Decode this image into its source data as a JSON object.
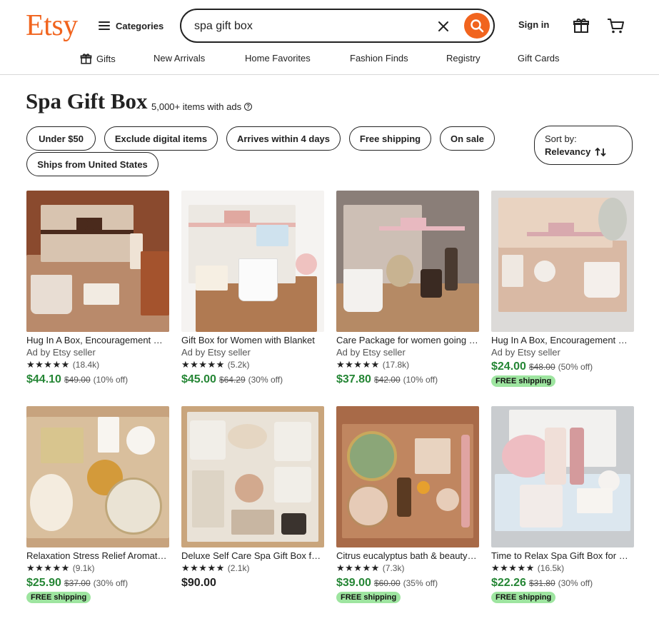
{
  "header": {
    "logo": "Etsy",
    "categories_label": "Categories",
    "search_value": "spa gift box",
    "signin_label": "Sign in"
  },
  "subnav": [
    "Gifts",
    "New Arrivals",
    "Home Favorites",
    "Fashion Finds",
    "Registry",
    "Gift Cards"
  ],
  "page": {
    "title": "Spa Gift Box",
    "count": "5,000+ items with ads",
    "help_icon": "?"
  },
  "filters": [
    "Under $50",
    "Exclude digital items",
    "Arrives within 4 days",
    "Free shipping",
    "On sale",
    "Ships from United States"
  ],
  "sort": {
    "label": "Sort by:",
    "value": "Relevancy"
  },
  "colors": {
    "brand": "#f1641e",
    "price_green": "#258635",
    "free_shipping_badge": "#9ee5a0"
  },
  "listings": [
    {
      "title": "Hug In A Box, Encouragement Gift Box",
      "ad": "Ad by Etsy seller",
      "stars": "★★★★★",
      "reviews": "(18.4k)",
      "price": "$44.10",
      "original": "$49.00",
      "discount": "(10% off)",
      "free_shipping": ""
    },
    {
      "title": "Gift Box for Women with Blanket",
      "ad": "Ad by Etsy seller",
      "stars": "★★★★★",
      "reviews": "(5.2k)",
      "price": "$45.00",
      "original": "$64.29",
      "discount": "(30% off)",
      "free_shipping": ""
    },
    {
      "title": "Care Package for women going through",
      "ad": "Ad by Etsy seller",
      "stars": "★★★★★",
      "reviews": "(17.8k)",
      "price": "$37.80",
      "original": "$42.00",
      "discount": "(10% off)",
      "free_shipping": ""
    },
    {
      "title": "Hug In A Box, Encouragement Gift Box",
      "ad": "Ad by Etsy seller",
      "stars": "",
      "reviews": "",
      "price": "$24.00",
      "original": "$48.00",
      "discount": "(50% off)",
      "free_shipping": "FREE shipping"
    },
    {
      "title": "Relaxation Stress Relief Aromatherapy Gift",
      "ad": "",
      "stars": "★★★★★",
      "reviews": "(9.1k)",
      "price": "$25.90",
      "original": "$37.00",
      "discount": "(30% off)",
      "free_shipping": "FREE shipping"
    },
    {
      "title": "Deluxe Self Care Spa Gift Box for Her",
      "ad": "",
      "stars": "★★★★★",
      "reviews": "(2.1k)",
      "price": "$90.00",
      "original": "",
      "discount": "",
      "free_shipping": ""
    },
    {
      "title": "Citrus eucalyptus bath & beauty gift set",
      "ad": "",
      "stars": "★★★★★",
      "reviews": "(7.3k)",
      "price": "$39.00",
      "original": "$60.00",
      "discount": "(35% off)",
      "free_shipping": "FREE shipping"
    },
    {
      "title": "Time to Relax Spa Gift Box for Women",
      "ad": "",
      "stars": "★★★★★",
      "reviews": "(16.5k)",
      "price": "$22.26",
      "original": "$31.80",
      "discount": "(30% off)",
      "free_shipping": "FREE shipping"
    }
  ]
}
